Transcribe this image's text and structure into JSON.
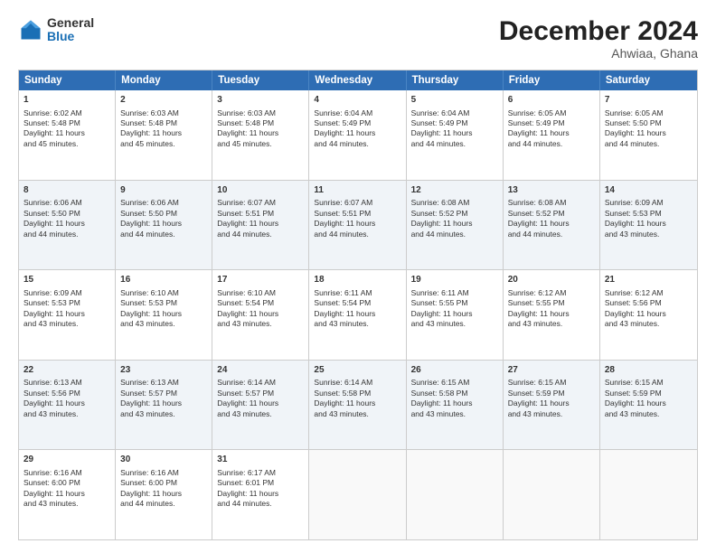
{
  "logo": {
    "general": "General",
    "blue": "Blue"
  },
  "title": "December 2024",
  "subtitle": "Ahwiaa, Ghana",
  "header_days": [
    "Sunday",
    "Monday",
    "Tuesday",
    "Wednesday",
    "Thursday",
    "Friday",
    "Saturday"
  ],
  "rows": [
    [
      {
        "day": "1",
        "lines": [
          "Sunrise: 6:02 AM",
          "Sunset: 5:48 PM",
          "Daylight: 11 hours",
          "and 45 minutes."
        ]
      },
      {
        "day": "2",
        "lines": [
          "Sunrise: 6:03 AM",
          "Sunset: 5:48 PM",
          "Daylight: 11 hours",
          "and 45 minutes."
        ]
      },
      {
        "day": "3",
        "lines": [
          "Sunrise: 6:03 AM",
          "Sunset: 5:48 PM",
          "Daylight: 11 hours",
          "and 45 minutes."
        ]
      },
      {
        "day": "4",
        "lines": [
          "Sunrise: 6:04 AM",
          "Sunset: 5:49 PM",
          "Daylight: 11 hours",
          "and 44 minutes."
        ]
      },
      {
        "day": "5",
        "lines": [
          "Sunrise: 6:04 AM",
          "Sunset: 5:49 PM",
          "Daylight: 11 hours",
          "and 44 minutes."
        ]
      },
      {
        "day": "6",
        "lines": [
          "Sunrise: 6:05 AM",
          "Sunset: 5:49 PM",
          "Daylight: 11 hours",
          "and 44 minutes."
        ]
      },
      {
        "day": "7",
        "lines": [
          "Sunrise: 6:05 AM",
          "Sunset: 5:50 PM",
          "Daylight: 11 hours",
          "and 44 minutes."
        ]
      }
    ],
    [
      {
        "day": "8",
        "lines": [
          "Sunrise: 6:06 AM",
          "Sunset: 5:50 PM",
          "Daylight: 11 hours",
          "and 44 minutes."
        ]
      },
      {
        "day": "9",
        "lines": [
          "Sunrise: 6:06 AM",
          "Sunset: 5:50 PM",
          "Daylight: 11 hours",
          "and 44 minutes."
        ]
      },
      {
        "day": "10",
        "lines": [
          "Sunrise: 6:07 AM",
          "Sunset: 5:51 PM",
          "Daylight: 11 hours",
          "and 44 minutes."
        ]
      },
      {
        "day": "11",
        "lines": [
          "Sunrise: 6:07 AM",
          "Sunset: 5:51 PM",
          "Daylight: 11 hours",
          "and 44 minutes."
        ]
      },
      {
        "day": "12",
        "lines": [
          "Sunrise: 6:08 AM",
          "Sunset: 5:52 PM",
          "Daylight: 11 hours",
          "and 44 minutes."
        ]
      },
      {
        "day": "13",
        "lines": [
          "Sunrise: 6:08 AM",
          "Sunset: 5:52 PM",
          "Daylight: 11 hours",
          "and 44 minutes."
        ]
      },
      {
        "day": "14",
        "lines": [
          "Sunrise: 6:09 AM",
          "Sunset: 5:53 PM",
          "Daylight: 11 hours",
          "and 43 minutes."
        ]
      }
    ],
    [
      {
        "day": "15",
        "lines": [
          "Sunrise: 6:09 AM",
          "Sunset: 5:53 PM",
          "Daylight: 11 hours",
          "and 43 minutes."
        ]
      },
      {
        "day": "16",
        "lines": [
          "Sunrise: 6:10 AM",
          "Sunset: 5:53 PM",
          "Daylight: 11 hours",
          "and 43 minutes."
        ]
      },
      {
        "day": "17",
        "lines": [
          "Sunrise: 6:10 AM",
          "Sunset: 5:54 PM",
          "Daylight: 11 hours",
          "and 43 minutes."
        ]
      },
      {
        "day": "18",
        "lines": [
          "Sunrise: 6:11 AM",
          "Sunset: 5:54 PM",
          "Daylight: 11 hours",
          "and 43 minutes."
        ]
      },
      {
        "day": "19",
        "lines": [
          "Sunrise: 6:11 AM",
          "Sunset: 5:55 PM",
          "Daylight: 11 hours",
          "and 43 minutes."
        ]
      },
      {
        "day": "20",
        "lines": [
          "Sunrise: 6:12 AM",
          "Sunset: 5:55 PM",
          "Daylight: 11 hours",
          "and 43 minutes."
        ]
      },
      {
        "day": "21",
        "lines": [
          "Sunrise: 6:12 AM",
          "Sunset: 5:56 PM",
          "Daylight: 11 hours",
          "and 43 minutes."
        ]
      }
    ],
    [
      {
        "day": "22",
        "lines": [
          "Sunrise: 6:13 AM",
          "Sunset: 5:56 PM",
          "Daylight: 11 hours",
          "and 43 minutes."
        ]
      },
      {
        "day": "23",
        "lines": [
          "Sunrise: 6:13 AM",
          "Sunset: 5:57 PM",
          "Daylight: 11 hours",
          "and 43 minutes."
        ]
      },
      {
        "day": "24",
        "lines": [
          "Sunrise: 6:14 AM",
          "Sunset: 5:57 PM",
          "Daylight: 11 hours",
          "and 43 minutes."
        ]
      },
      {
        "day": "25",
        "lines": [
          "Sunrise: 6:14 AM",
          "Sunset: 5:58 PM",
          "Daylight: 11 hours",
          "and 43 minutes."
        ]
      },
      {
        "day": "26",
        "lines": [
          "Sunrise: 6:15 AM",
          "Sunset: 5:58 PM",
          "Daylight: 11 hours",
          "and 43 minutes."
        ]
      },
      {
        "day": "27",
        "lines": [
          "Sunrise: 6:15 AM",
          "Sunset: 5:59 PM",
          "Daylight: 11 hours",
          "and 43 minutes."
        ]
      },
      {
        "day": "28",
        "lines": [
          "Sunrise: 6:15 AM",
          "Sunset: 5:59 PM",
          "Daylight: 11 hours",
          "and 43 minutes."
        ]
      }
    ],
    [
      {
        "day": "29",
        "lines": [
          "Sunrise: 6:16 AM",
          "Sunset: 6:00 PM",
          "Daylight: 11 hours",
          "and 43 minutes."
        ]
      },
      {
        "day": "30",
        "lines": [
          "Sunrise: 6:16 AM",
          "Sunset: 6:00 PM",
          "Daylight: 11 hours",
          "and 44 minutes."
        ]
      },
      {
        "day": "31",
        "lines": [
          "Sunrise: 6:17 AM",
          "Sunset: 6:01 PM",
          "Daylight: 11 hours",
          "and 44 minutes."
        ]
      },
      {
        "day": "",
        "lines": []
      },
      {
        "day": "",
        "lines": []
      },
      {
        "day": "",
        "lines": []
      },
      {
        "day": "",
        "lines": []
      }
    ]
  ]
}
